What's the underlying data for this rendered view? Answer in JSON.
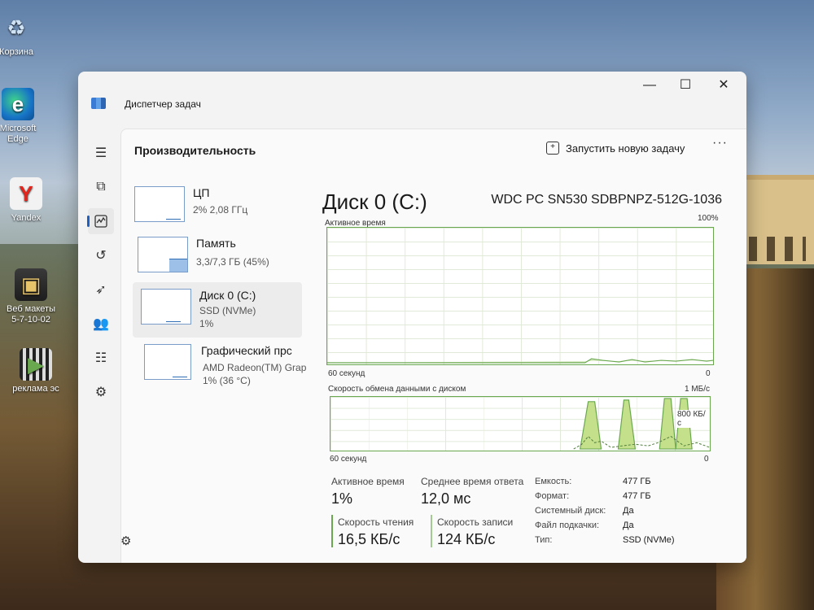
{
  "desktop": {
    "icons": [
      {
        "label": "Корзина"
      },
      {
        "label": "Microsoft Edge"
      },
      {
        "label": "Yandex"
      },
      {
        "label": "Веб макеты 5-7-10-02"
      },
      {
        "label": "реклама эс"
      }
    ]
  },
  "window": {
    "title": "Диспетчер задач",
    "controls": {
      "minimize": "—",
      "maximize": "☐",
      "close": "✕"
    }
  },
  "header": {
    "page_title": "Производительность",
    "run_task_label": "Запустить новую задачу",
    "more_label": "···"
  },
  "devices": [
    {
      "name": "ЦП",
      "line1": "2% 2,08 ГГц",
      "line2": ""
    },
    {
      "name": "Память",
      "line1": "3,3/7,3 ГБ (45%)",
      "line2": ""
    },
    {
      "name": "Диск 0 (C:)",
      "line1": "SSD (NVMe)",
      "line2": "1%"
    },
    {
      "name": "Графический прс",
      "line1": "AMD Radeon(TM) Grap",
      "line2": "1% (36 °C)"
    }
  ],
  "disk": {
    "title": "Диск 0 (C:)",
    "model": "WDC PC SN530 SDBPNPZ-512G-1036",
    "chart1": {
      "label": "Активное время",
      "max_label": "100%",
      "x_label": "60 секунд",
      "min_label": "0"
    },
    "chart2": {
      "label": "Скорость обмена данными с диском",
      "max_label": "1 МБ/с",
      "mid_label": "800 КБ/с",
      "x_label": "60 секунд",
      "min_label": "0"
    },
    "stats": {
      "active_time_label": "Активное время",
      "active_time": "1%",
      "response_label": "Среднее время ответа",
      "response": "12,0 мс",
      "read_label": "Скорость чтения",
      "read": "16,5 КБ/с",
      "write_label": "Скорость записи",
      "write": "124 КБ/с"
    },
    "props": [
      {
        "k": "Емкость:",
        "v": "477 ГБ"
      },
      {
        "k": "Формат:",
        "v": "477 ГБ"
      },
      {
        "k": "Системный диск:",
        "v": "Да"
      },
      {
        "k": "Файл подкачки:",
        "v": "Да"
      },
      {
        "k": "Тип:",
        "v": "SSD (NVMe)"
      }
    ]
  },
  "colors": {
    "accent": "#1f5fbf",
    "disk_green": "#6aa84f",
    "disk_fill": "#c5e08a"
  }
}
